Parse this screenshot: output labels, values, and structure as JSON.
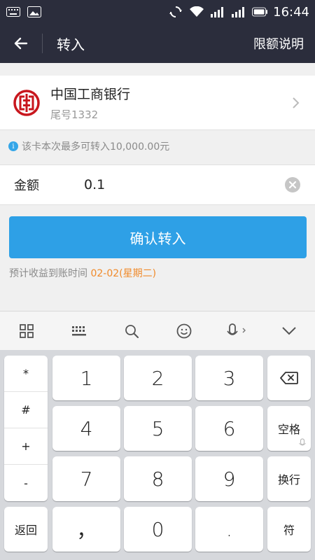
{
  "status": {
    "time": "16:44"
  },
  "nav": {
    "title": "转入",
    "right_label": "限额说明"
  },
  "bank": {
    "name": "中国工商银行",
    "tail": "尾号1332",
    "logo_color": "#c8161d"
  },
  "info": {
    "icon": "i",
    "text": "该卡本次最多可转入10,000.00元"
  },
  "amount": {
    "label": "金额",
    "value": "0.1"
  },
  "confirm": {
    "label": "确认转入",
    "color": "#2ea0e6"
  },
  "eta": {
    "prefix": "预计收益到账时间",
    "date": "02-02(星期二)",
    "date_color": "#f08a2a"
  },
  "keyboard": {
    "side": [
      "*",
      "#",
      "+",
      "-"
    ],
    "digits": [
      "1",
      "2",
      "3",
      "4",
      "5",
      "6",
      "7",
      "8",
      "9"
    ],
    "bottom": {
      "back": "返回",
      "comma": "，",
      "zero": "0",
      "dot": ".",
      "symbol": "符"
    },
    "right": {
      "space": "空格",
      "enter": "换行"
    }
  }
}
